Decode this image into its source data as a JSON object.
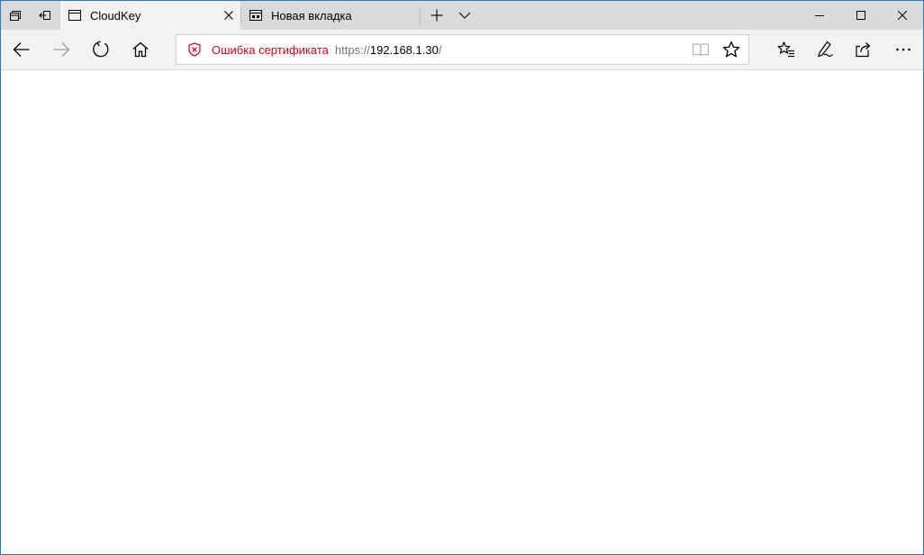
{
  "tabs": [
    {
      "title": "CloudKey",
      "active": true,
      "favicon": "page-icon"
    },
    {
      "title": "Новая вкладка",
      "active": false,
      "favicon": "new-tab-page-icon"
    }
  ],
  "address_bar": {
    "security_status": "Ошибка сертификата",
    "url_scheme": "https://",
    "url_host": "192.168.1.30",
    "url_path": "/"
  },
  "colors": {
    "accent_border": "#2b79c2",
    "cert_error": "#d0021b",
    "titlebar": "#dadada",
    "toolbar": "#f2f2f2"
  },
  "icons": {
    "titlebar": [
      "set-tabs-aside-icon",
      "restore-tabs-icon"
    ],
    "tabbar": [
      "new-tab-icon",
      "tab-preview-chevron-icon"
    ],
    "window_controls": [
      "minimize-icon",
      "maximize-icon",
      "close-window-icon"
    ],
    "navigation": [
      "back-arrow-icon",
      "forward-arrow-icon",
      "refresh-icon",
      "home-icon"
    ],
    "address": [
      "certificate-error-shield-icon",
      "reading-view-icon",
      "favorite-star-icon"
    ],
    "toolbar_right": [
      "favorites-hub-icon",
      "web-note-pen-icon",
      "share-icon",
      "more-ellipsis-icon"
    ]
  }
}
